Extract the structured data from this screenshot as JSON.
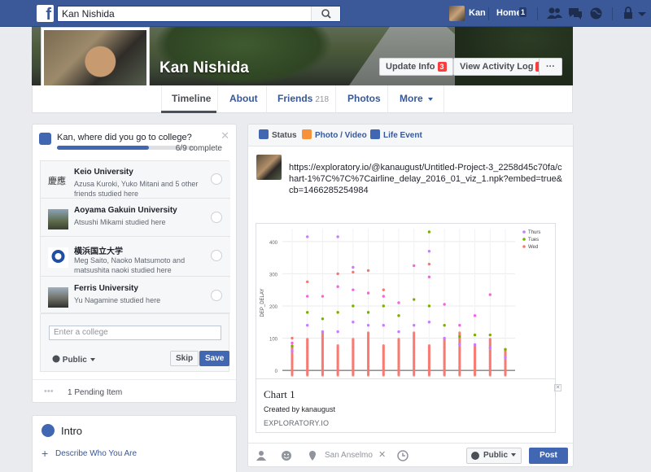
{
  "topbar": {
    "search_value": "Kan Nishida",
    "user_name": "Kan",
    "home_label": "Home",
    "home_badge": "1"
  },
  "profile": {
    "name": "Kan Nishida",
    "update_info_label": "Update Info",
    "update_info_badge": "3",
    "activity_log_label": "View Activity Log",
    "activity_log_badge": "1",
    "more_dots": "···"
  },
  "nav": {
    "timeline": "Timeline",
    "about": "About",
    "friends": "Friends",
    "friends_count": "218",
    "photos": "Photos",
    "more": "More"
  },
  "college": {
    "question": "Kan, where did you go to college?",
    "progress_text": "6/9 complete",
    "progress_fraction": 0.6667,
    "items": [
      {
        "name": "Keio University",
        "sub": "Azusa Kuroki, Yuko Mitani and 5 other friends studied here"
      },
      {
        "name": "Aoyama Gakuin University",
        "sub": "Atsushi Mikami studied here"
      },
      {
        "name": "横浜国立大学",
        "sub": "Meg Saito, Naoko Matsumoto and matsushita naoki studied here"
      },
      {
        "name": "Ferris University",
        "sub": "Yu Nagamine studied here"
      }
    ],
    "keio_logo_text": "慶應",
    "input_placeholder": "Enter a college",
    "public_label": "Public",
    "skip_label": "Skip",
    "save_label": "Save",
    "pending_label": "1 Pending Item"
  },
  "intro": {
    "title": "Intro",
    "describe_link": "Describe Who You Are"
  },
  "composer": {
    "tab_status": "Status",
    "tab_photo": "Photo / Video",
    "tab_life": "Life Event",
    "post_text": "https://exploratory.io/@kanaugust/Untitled-Project-3_2258d45c70fa/chart-1%7C%7C%7Cairline_delay_2016_01_viz_1.npk?embed=true&cb=1466285254984",
    "preview_title": "Chart 1",
    "preview_sub": "Created by kanaugust",
    "preview_domain": "EXPLORATORY.IO",
    "location": "San Anselmo",
    "public_label": "Public",
    "post_label": "Post"
  },
  "chart_data": {
    "type": "scatter",
    "title": "",
    "xlabel": "",
    "ylabel": "DEP_DELAY",
    "ylim": [
      -20,
      440
    ],
    "yticks": [
      0,
      100,
      200,
      300,
      400
    ],
    "grid": true,
    "legend_position": "top-right",
    "series": [
      {
        "name": "Thurs",
        "color": "#c77cff"
      },
      {
        "name": "Tues",
        "color": "#7cae00"
      },
      {
        "name": "Wed",
        "color": "#f8766d"
      }
    ],
    "columns": [
      {
        "x": 1,
        "max": 105,
        "outliers": [
          60,
          75,
          85,
          100
        ]
      },
      {
        "x": 2,
        "max": 415,
        "outliers": [
          140,
          180,
          230,
          275,
          415
        ]
      },
      {
        "x": 3,
        "max": 230,
        "outliers": [
          120,
          160,
          230
        ]
      },
      {
        "x": 4,
        "max": 415,
        "outliers": [
          120,
          180,
          260,
          300,
          415
        ]
      },
      {
        "x": 5,
        "max": 320,
        "outliers": [
          150,
          200,
          250,
          305,
          320
        ]
      },
      {
        "x": 6,
        "max": 310,
        "outliers": [
          140,
          180,
          240,
          310
        ]
      },
      {
        "x": 7,
        "max": 250,
        "outliers": [
          140,
          200,
          230,
          250
        ]
      },
      {
        "x": 8,
        "max": 210,
        "outliers": [
          120,
          170,
          210
        ]
      },
      {
        "x": 9,
        "max": 325,
        "outliers": [
          140,
          220,
          325
        ]
      },
      {
        "x": 10,
        "max": 430,
        "outliers": [
          150,
          200,
          290,
          330,
          370,
          430
        ]
      },
      {
        "x": 11,
        "max": 205,
        "outliers": [
          100,
          140,
          205
        ]
      },
      {
        "x": 12,
        "max": 140,
        "outliers": [
          80,
          105,
          140
        ]
      },
      {
        "x": 13,
        "max": 170,
        "outliers": [
          80,
          110,
          170
        ]
      },
      {
        "x": 14,
        "max": 235,
        "outliers": [
          70,
          110,
          235
        ]
      },
      {
        "x": 15,
        "max": 65,
        "outliers": [
          40,
          65
        ]
      }
    ]
  }
}
